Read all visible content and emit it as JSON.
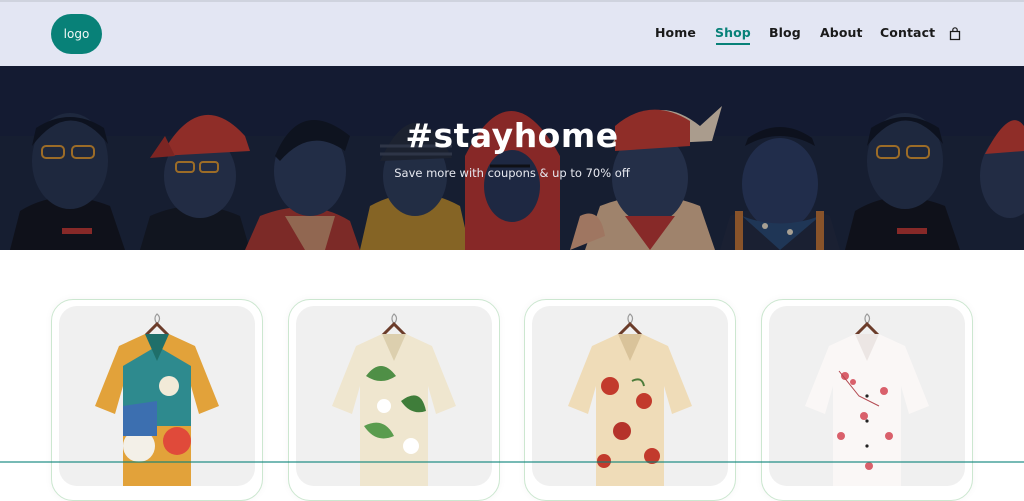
{
  "header": {
    "logo_text": "logo",
    "nav": [
      {
        "label": "Home",
        "active": false
      },
      {
        "label": "Shop",
        "active": true
      },
      {
        "label": "Blog",
        "active": false
      },
      {
        "label": "About",
        "active": false
      },
      {
        "label": "Contact",
        "active": false
      }
    ],
    "cart_icon": "shopping-bag-icon"
  },
  "hero": {
    "title": "#stayhome",
    "subtitle": "Save more with coupons & up to 70% off"
  },
  "products": [
    {
      "image": "shirt-patchwork-floral"
    },
    {
      "image": "shirt-green-leaf-floral"
    },
    {
      "image": "shirt-red-floral"
    },
    {
      "image": "shirt-white-cherry-blossom"
    }
  ],
  "colors": {
    "accent": "#088178",
    "header_bg": "#e3e6f3",
    "hero_bg": "#1a2236"
  }
}
